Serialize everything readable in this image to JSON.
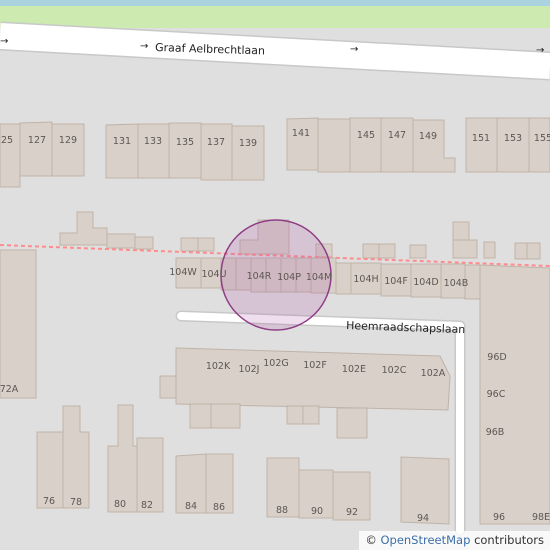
{
  "map": {
    "colors": {
      "land": "#e0dfdf",
      "grass": "#cdebb0",
      "water": "#aad3df",
      "building": "#d9d0c9",
      "building_outline": "#bfb3a8",
      "road": "#ffffff",
      "rail": "#ff7777",
      "marker_fill": "#b15aa8",
      "marker_stroke": "#8e3d86"
    },
    "streets": {
      "main": "Graaf Aelbrechtlaan",
      "side": "Heemraadschapslaan"
    },
    "oneway_arrow": "→",
    "house_numbers": {
      "top_row": [
        "25",
        "127",
        "129",
        "131",
        "133",
        "135",
        "137",
        "139",
        "141",
        "145",
        "147",
        "149",
        "151",
        "153",
        "155"
      ],
      "middle_row": [
        "104W",
        "104U",
        "104R",
        "104P",
        "104M",
        "104H",
        "104F",
        "104D",
        "104B"
      ],
      "lower_row": [
        "102K",
        "102J",
        "102G",
        "102F",
        "102E",
        "102C",
        "102A"
      ],
      "right_column": [
        "96D",
        "96C",
        "96B",
        "96",
        "98E"
      ],
      "bottom_row": [
        "76",
        "78",
        "80",
        "82",
        "84",
        "86",
        "88",
        "90",
        "92",
        "94"
      ],
      "left_edge": "72A"
    },
    "attribution": {
      "symbol": "©",
      "link_text": "OpenStreetMap",
      "suffix": "contributors"
    }
  }
}
